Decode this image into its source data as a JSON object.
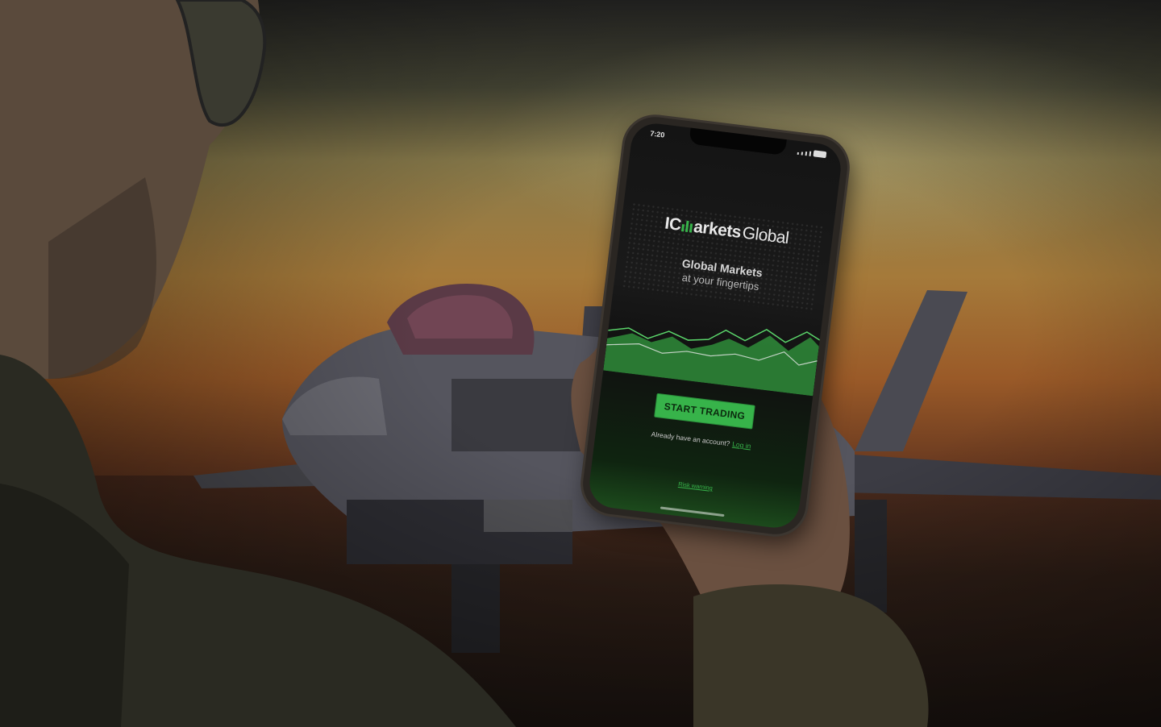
{
  "phone": {
    "status_time": "7:20",
    "logo": {
      "ic": "IC",
      "markets": "arkets",
      "global": "Global",
      "accent_color": "#37b34a"
    },
    "headline": "Global Markets",
    "subline": "at your fingertips",
    "cta_label": "START TRADING",
    "login_prompt": "Already have an account?",
    "login_link": "Log in",
    "risk_link": "Risk warning"
  }
}
